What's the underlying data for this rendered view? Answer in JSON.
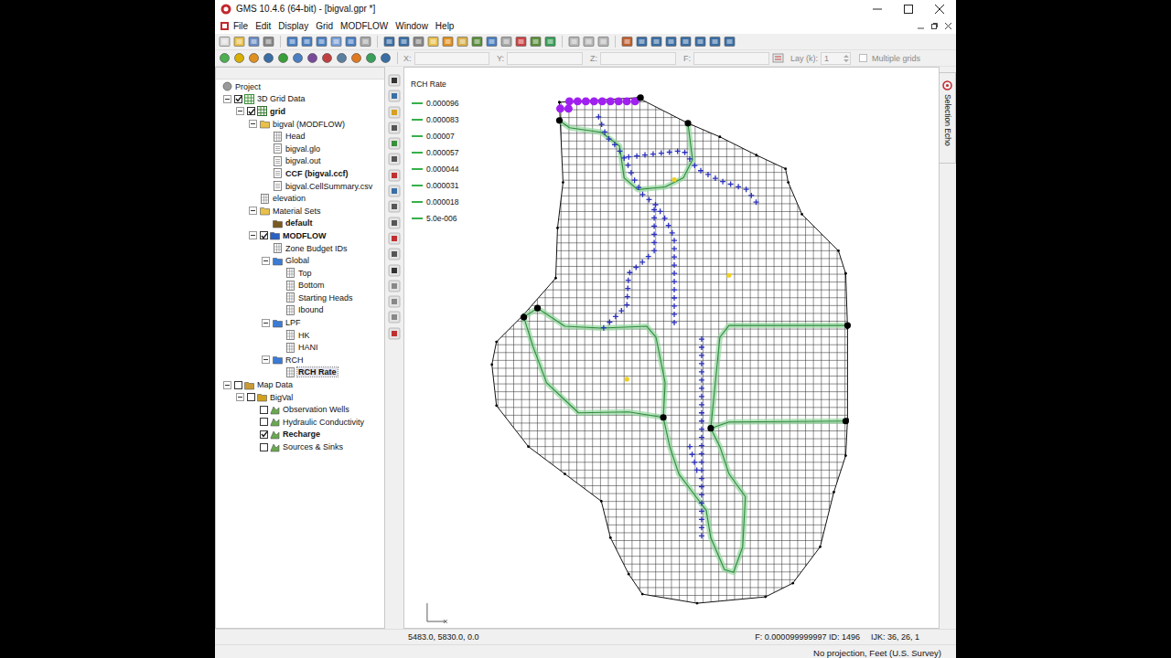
{
  "window": {
    "title": "GMS 10.4.6 (64-bit) - [bigval.gpr *]"
  },
  "menu": [
    "File",
    "Edit",
    "Display",
    "Grid",
    "MODFLOW",
    "Window",
    "Help"
  ],
  "toolbar": {
    "coords": [
      {
        "label": "X:",
        "disabled": true
      },
      {
        "label": "Y:",
        "disabled": true
      },
      {
        "label": "Z:",
        "disabled": true
      },
      {
        "label": "F:",
        "disabled": true
      }
    ],
    "layer": {
      "label": "Lay (k):",
      "value": "1",
      "disabled": true
    },
    "multiple_grids": {
      "label": "Multiple grids",
      "checked": false,
      "disabled": true
    }
  },
  "tree": [
    {
      "label": "Project",
      "level": 0,
      "kind": "project",
      "checkbox": null,
      "expanded": null,
      "bold": false,
      "selected": false
    },
    {
      "label": "3D Grid Data",
      "level": 1,
      "kind": "grid-data",
      "checkbox": true,
      "expanded": true,
      "bold": false,
      "selected": false
    },
    {
      "label": "grid",
      "level": 2,
      "kind": "grid",
      "checkbox": true,
      "expanded": true,
      "bold": true,
      "selected": false
    },
    {
      "label": "bigval (MODFLOW)",
      "level": 3,
      "kind": "folder",
      "checkbox": null,
      "expanded": true,
      "bold": false,
      "selected": false
    },
    {
      "label": "Head",
      "level": 4,
      "kind": "dataset",
      "checkbox": null,
      "expanded": null,
      "bold": false,
      "selected": false
    },
    {
      "label": "bigval.glo",
      "level": 4,
      "kind": "file",
      "checkbox": null,
      "expanded": null,
      "bold": false,
      "selected": false
    },
    {
      "label": "bigval.out",
      "level": 4,
      "kind": "file",
      "checkbox": null,
      "expanded": null,
      "bold": false,
      "selected": false
    },
    {
      "label": "CCF (bigval.ccf)",
      "level": 4,
      "kind": "ccf",
      "checkbox": null,
      "expanded": null,
      "bold": true,
      "selected": false
    },
    {
      "label": "bigval.CellSummary.csv",
      "level": 4,
      "kind": "file",
      "checkbox": null,
      "expanded": null,
      "bold": false,
      "selected": false
    },
    {
      "label": "elevation",
      "level": 3,
      "kind": "dataset",
      "checkbox": null,
      "expanded": null,
      "bold": false,
      "selected": false
    },
    {
      "label": "Material Sets",
      "level": 3,
      "kind": "folder",
      "checkbox": null,
      "expanded": true,
      "bold": false,
      "selected": false
    },
    {
      "label": "default",
      "level": 4,
      "kind": "materials",
      "checkbox": null,
      "expanded": null,
      "bold": true,
      "selected": false
    },
    {
      "label": "MODFLOW",
      "level": 3,
      "kind": "model",
      "checkbox": true,
      "expanded": true,
      "bold": true,
      "selected": false
    },
    {
      "label": "Zone Budget IDs",
      "level": 4,
      "kind": "dataset",
      "checkbox": null,
      "expanded": null,
      "bold": false,
      "selected": false
    },
    {
      "label": "Global",
      "level": 4,
      "kind": "package",
      "checkbox": null,
      "expanded": true,
      "bold": false,
      "selected": false
    },
    {
      "label": "Top",
      "level": 5,
      "kind": "dataset",
      "checkbox": null,
      "expanded": null,
      "bold": false,
      "selected": false
    },
    {
      "label": "Bottom",
      "level": 5,
      "kind": "dataset",
      "checkbox": null,
      "expanded": null,
      "bold": false,
      "selected": false
    },
    {
      "label": "Starting Heads",
      "level": 5,
      "kind": "dataset",
      "checkbox": null,
      "expanded": null,
      "bold": false,
      "selected": false
    },
    {
      "label": "Ibound",
      "level": 5,
      "kind": "dataset",
      "checkbox": null,
      "expanded": null,
      "bold": false,
      "selected": false
    },
    {
      "label": "LPF",
      "level": 4,
      "kind": "package",
      "checkbox": null,
      "expanded": true,
      "bold": false,
      "selected": false
    },
    {
      "label": "HK",
      "level": 5,
      "kind": "dataset",
      "checkbox": null,
      "expanded": null,
      "bold": false,
      "selected": false
    },
    {
      "label": "HANI",
      "level": 5,
      "kind": "dataset",
      "checkbox": null,
      "expanded": null,
      "bold": false,
      "selected": false
    },
    {
      "label": "RCH",
      "level": 4,
      "kind": "package",
      "checkbox": null,
      "expanded": true,
      "bold": false,
      "selected": false
    },
    {
      "label": "RCH Rate",
      "level": 5,
      "kind": "dataset",
      "checkbox": null,
      "expanded": null,
      "bold": true,
      "selected": true
    },
    {
      "label": "Map Data",
      "level": 1,
      "kind": "map-data",
      "checkbox": false,
      "expanded": true,
      "bold": false,
      "selected": false
    },
    {
      "label": "BigVal",
      "level": 2,
      "kind": "conceptual",
      "checkbox": false,
      "expanded": true,
      "bold": false,
      "selected": false
    },
    {
      "label": "Observation Wells",
      "level": 3,
      "kind": "coverage",
      "checkbox": false,
      "expanded": null,
      "bold": false,
      "selected": false
    },
    {
      "label": "Hydraulic Conductivity",
      "level": 3,
      "kind": "coverage",
      "checkbox": false,
      "expanded": null,
      "bold": false,
      "selected": false
    },
    {
      "label": "Recharge",
      "level": 3,
      "kind": "coverage",
      "checkbox": true,
      "expanded": null,
      "bold": true,
      "selected": false
    },
    {
      "label": "Sources & Sinks",
      "level": 3,
      "kind": "coverage",
      "checkbox": false,
      "expanded": null,
      "bold": false,
      "selected": false
    }
  ],
  "legend": {
    "title": "RCH Rate",
    "entries": [
      "0.000096",
      "0.000083",
      "0.00007",
      "0.000057",
      "0.000044",
      "0.000031",
      "0.000018",
      "5.0e-006"
    ]
  },
  "side_tab": {
    "label": "Selection Echo"
  },
  "status_bar": {
    "coords": "5483.0, 5830.0, 0.0",
    "info": "F: 0.000099999997 ID: 1496",
    "ijk": "IJK: 36, 26, 1",
    "projection": "No projection, Feet (U.S. Survey)"
  }
}
